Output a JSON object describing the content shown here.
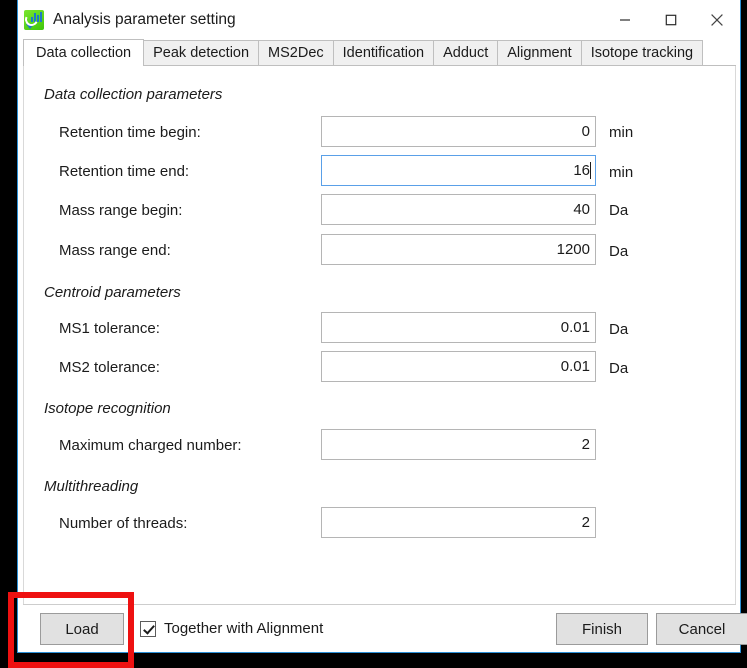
{
  "window": {
    "title": "Analysis parameter setting",
    "app_icon": "analysis-app-icon",
    "controls": {
      "minimize": "minimize-icon",
      "maximize": "maximize-icon",
      "close": "close-icon"
    }
  },
  "tabs": [
    {
      "label": "Data collection",
      "active": true
    },
    {
      "label": "Peak detection",
      "active": false
    },
    {
      "label": "MS2Dec",
      "active": false
    },
    {
      "label": "Identification",
      "active": false
    },
    {
      "label": "Adduct",
      "active": false
    },
    {
      "label": "Alignment",
      "active": false
    },
    {
      "label": "Isotope tracking",
      "active": false
    }
  ],
  "groups": [
    {
      "title": "Data collection parameters",
      "fields": [
        {
          "label": "Retention time begin:",
          "value": "0",
          "unit": "min",
          "focused": false
        },
        {
          "label": "Retention time end:",
          "value": "16",
          "unit": "min",
          "focused": true
        },
        {
          "label": "Mass range begin:",
          "value": "40",
          "unit": "Da",
          "focused": false
        },
        {
          "label": "Mass range end:",
          "value": "1200",
          "unit": "Da",
          "focused": false
        }
      ]
    },
    {
      "title": "Centroid parameters",
      "fields": [
        {
          "label": "MS1 tolerance:",
          "value": "0.01",
          "unit": "Da",
          "focused": false
        },
        {
          "label": "MS2 tolerance:",
          "value": "0.01",
          "unit": "Da",
          "focused": false
        }
      ]
    },
    {
      "title": "Isotope recognition",
      "fields": [
        {
          "label": "Maximum charged number:",
          "value": "2",
          "unit": "",
          "focused": false
        }
      ]
    },
    {
      "title": "Multithreading",
      "fields": [
        {
          "label": "Number of threads:",
          "value": "2",
          "unit": "",
          "focused": false
        }
      ]
    }
  ],
  "footer": {
    "load_label": "Load",
    "checkbox_label": "Together with Alignment",
    "checkbox_checked": true,
    "finish_label": "Finish",
    "cancel_label": "Cancel"
  },
  "annotation": {
    "color": "#ee1111",
    "target": "load-button"
  }
}
